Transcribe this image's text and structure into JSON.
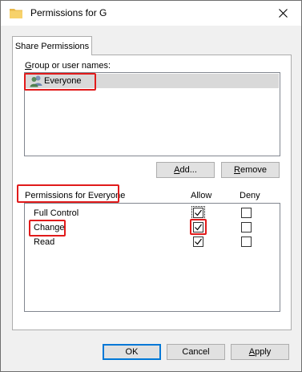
{
  "window": {
    "title": "Permissions for G"
  },
  "tabs": [
    {
      "label": "Share Permissions"
    }
  ],
  "groups": {
    "label": "Group or user names:",
    "items": [
      {
        "name": "Everyone",
        "selected": true
      }
    ]
  },
  "buttons": {
    "add": "Add...",
    "remove": "Remove",
    "ok": "OK",
    "cancel": "Cancel",
    "apply": "Apply"
  },
  "permissions": {
    "heading": "Permissions for Everyone",
    "allow_header": "Allow",
    "deny_header": "Deny",
    "rows": [
      {
        "name": "Full Control",
        "allow": true,
        "deny": false
      },
      {
        "name": "Change",
        "allow": true,
        "deny": false
      },
      {
        "name": "Read",
        "allow": true,
        "deny": false
      }
    ]
  },
  "highlight_color": "#e11b1b"
}
